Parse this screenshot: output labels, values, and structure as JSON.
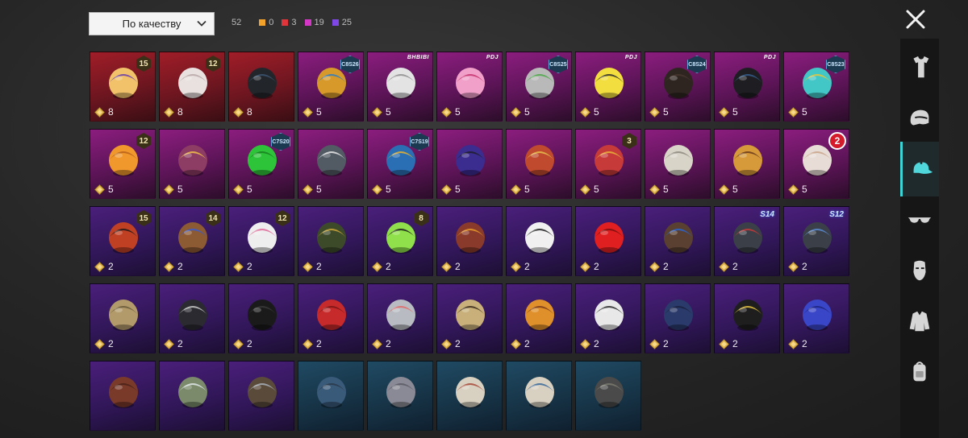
{
  "sort": {
    "label": "По качеству"
  },
  "counts": {
    "total": "52",
    "items": [
      {
        "color": "#f4a32a",
        "value": "0"
      },
      {
        "color": "#e0353b",
        "value": "3"
      },
      {
        "color": "#d437c6",
        "value": "19"
      },
      {
        "color": "#7f47e6",
        "value": "25"
      }
    ]
  },
  "sidebar": {
    "tabs": [
      {
        "icon": "outfit-icon",
        "active": false
      },
      {
        "icon": "helmet-icon",
        "active": false
      },
      {
        "icon": "cap-icon",
        "active": true
      },
      {
        "icon": "glasses-icon",
        "active": false
      },
      {
        "icon": "mask-icon",
        "active": false
      },
      {
        "icon": "jacket-icon",
        "active": false
      },
      {
        "icon": "backpack-icon",
        "active": false
      }
    ]
  },
  "grid": {
    "rows": [
      [
        {
          "rarity": "red",
          "qty": "8",
          "badge": "15",
          "badge_type": "lvl",
          "item": "blonde-hair-bow",
          "c1": "#f1c26a",
          "c2": "#6b3fa8"
        },
        {
          "rarity": "red",
          "qty": "8",
          "badge": "12",
          "badge_type": "lvl",
          "item": "white-hair-ears",
          "c1": "#e8e1df",
          "c2": "#b9a8a8"
        },
        {
          "rarity": "red",
          "qty": "8",
          "badge": "",
          "badge_type": "",
          "item": "dark-helmet-visor",
          "c1": "#22262b",
          "c2": "#3b5470"
        },
        {
          "rarity": "mag",
          "qty": "5",
          "badge": "C8S26",
          "badge_type": "cs",
          "item": "golden-dog-head",
          "c1": "#d79a2a",
          "c2": "#2e7cc1"
        },
        {
          "rarity": "mag",
          "qty": "5",
          "badge": "BHBIBI",
          "badge_type": "logo",
          "item": "security-camera-hat",
          "c1": "#e3e3e3",
          "c2": "#8e8e8e"
        },
        {
          "rarity": "mag",
          "qty": "5",
          "badge": "PDJ",
          "badge_type": "logo",
          "item": "pink-bow-headband",
          "c1": "#f1a0c9",
          "c2": "#c7326f"
        },
        {
          "rarity": "mag",
          "qty": "5",
          "badge": "C8S25",
          "badge_type": "cs",
          "item": "grey-hair-frog",
          "c1": "#b9b9b9",
          "c2": "#4da84a"
        },
        {
          "rarity": "mag",
          "qty": "5",
          "badge": "PDJ",
          "badge_type": "logo",
          "item": "yellow-box-head",
          "c1": "#f2de3f",
          "c2": "#2d2d2d"
        },
        {
          "rarity": "mag",
          "qty": "5",
          "badge": "C8S24",
          "badge_type": "cs",
          "item": "dark-bob-hair",
          "c1": "#2f2520",
          "c2": "#463630"
        },
        {
          "rarity": "mag",
          "qty": "5",
          "badge": "PDJ",
          "badge_type": "logo",
          "item": "black-hair-bun",
          "c1": "#1e1e22",
          "c2": "#355d8a"
        },
        {
          "rarity": "mag",
          "qty": "5",
          "badge": "C8S23",
          "badge_type": "cs",
          "item": "cat-headphones",
          "c1": "#43c6c6",
          "c2": "#e7c43a"
        }
      ],
      [
        {
          "rarity": "mag",
          "qty": "5",
          "badge": "12",
          "badge_type": "lvl",
          "item": "orange-fox-hair",
          "c1": "#f0982c",
          "c2": "#b9621b"
        },
        {
          "rarity": "mag",
          "qty": "5",
          "badge": "",
          "badge_type": "",
          "item": "purple-mohawk-hair",
          "c1": "#8d3c63",
          "c2": "#f0c04a"
        },
        {
          "rarity": "mag",
          "qty": "5",
          "badge": "C7S20",
          "badge_type": "cs",
          "item": "green-pigtails",
          "c1": "#2ec43a",
          "c2": "#16801f"
        },
        {
          "rarity": "mag",
          "qty": "5",
          "badge": "",
          "badge_type": "",
          "item": "shark-hood",
          "c1": "#525a63",
          "c2": "#e8e8e8"
        },
        {
          "rarity": "mag",
          "qty": "5",
          "badge": "C7S19",
          "badge_type": "cs",
          "item": "aztec-feather-headdress",
          "c1": "#2a6fb3",
          "c2": "#e7b32e"
        },
        {
          "rarity": "mag",
          "qty": "5",
          "badge": "",
          "badge_type": "",
          "item": "purple-space-helmet",
          "c1": "#3b2c8f",
          "c2": "#1e1e2a"
        },
        {
          "rarity": "mag",
          "qty": "5",
          "badge": "",
          "badge_type": "",
          "item": "carnival-hat-mask",
          "c1": "#c04a2d",
          "c2": "#e5c04e"
        },
        {
          "rarity": "mag",
          "qty": "5",
          "badge": "3",
          "badge_type": "lvl",
          "item": "jester-hat",
          "c1": "#c73a3a",
          "c2": "#e8b13a"
        },
        {
          "rarity": "mag",
          "qty": "5",
          "badge": "",
          "badge_type": "",
          "item": "lion-mane-mask",
          "c1": "#d9d4c8",
          "c2": "#8e8a80"
        },
        {
          "rarity": "mag",
          "qty": "5",
          "badge": "",
          "badge_type": "",
          "item": "golden-dragon-helmet",
          "c1": "#d69a3a",
          "c2": "#6a3a1c"
        },
        {
          "rarity": "mag",
          "qty": "5",
          "badge": "2",
          "badge_type": "red",
          "item": "bunny-mask",
          "c1": "#e8ddd6",
          "c2": "#c9a48c"
        }
      ],
      [
        {
          "rarity": "pur",
          "qty": "2",
          "badge": "15",
          "badge_type": "lvl",
          "item": "red-masked-hair",
          "c1": "#c04024",
          "c2": "#1f1a1a"
        },
        {
          "rarity": "pur",
          "qty": "2",
          "badge": "14",
          "badge_type": "lvl",
          "item": "brown-hair-blue-bow",
          "c1": "#8c5a33",
          "c2": "#3a5cd1"
        },
        {
          "rarity": "pur",
          "qty": "2",
          "badge": "12",
          "badge_type": "lvl",
          "item": "bunny-ears-helmet",
          "c1": "#eeeeee",
          "c2": "#e06a9a"
        },
        {
          "rarity": "pur",
          "qty": "2",
          "badge": "",
          "badge_type": "",
          "item": "officer-cap",
          "c1": "#3d4a2a",
          "c2": "#c9a43a"
        },
        {
          "rarity": "pur",
          "qty": "2",
          "badge": "8",
          "badge_type": "lvl",
          "item": "green-skull-hood",
          "c1": "#8fe04a",
          "c2": "#1e1e1e"
        },
        {
          "rarity": "pur",
          "qty": "2",
          "badge": "",
          "badge_type": "",
          "item": "aviator-hat-goggles",
          "c1": "#8a3a2a",
          "c2": "#e59a2a"
        },
        {
          "rarity": "pur",
          "qty": "2",
          "badge": "",
          "badge_type": "",
          "item": "white-sun-hat",
          "c1": "#f0f0f0",
          "c2": "#1e1e1e"
        },
        {
          "rarity": "pur",
          "qty": "2",
          "badge": "",
          "badge_type": "",
          "item": "red-mohawk",
          "c1": "#e02020",
          "c2": "#7a0f0f"
        },
        {
          "rarity": "pur",
          "qty": "2",
          "badge": "",
          "badge_type": "",
          "item": "long-brown-hair",
          "c1": "#5a4030",
          "c2": "#2a64d0"
        },
        {
          "rarity": "pur",
          "qty": "2",
          "badge": "S14",
          "badge_type": "s",
          "item": "spartan-helmet-s14",
          "c1": "#3a3f48",
          "c2": "#c43a3a"
        },
        {
          "rarity": "pur",
          "qty": "2",
          "badge": "S12",
          "badge_type": "s",
          "item": "space-helmet-s12",
          "c1": "#3a3f48",
          "c2": "#5a8ad0"
        }
      ],
      [
        {
          "rarity": "pur",
          "qty": "2",
          "badge": "",
          "badge_type": "",
          "item": "scarecrow-hat",
          "c1": "#b39a6a",
          "c2": "#6a5a3a"
        },
        {
          "rarity": "pur",
          "qty": "2",
          "badge": "",
          "badge_type": "",
          "item": "luchador-mask",
          "c1": "#2a2a30",
          "c2": "#c8c8c8"
        },
        {
          "rarity": "pur",
          "qty": "2",
          "badge": "",
          "badge_type": "",
          "item": "black-top-hat",
          "c1": "#1a1a1a",
          "c2": "#3a3a3a"
        },
        {
          "rarity": "pur",
          "qty": "2",
          "badge": "",
          "badge_type": "",
          "item": "red-fedora",
          "c1": "#c72a2a",
          "c2": "#7a1515"
        },
        {
          "rarity": "pur",
          "qty": "2",
          "badge": "",
          "badge_type": "",
          "item": "shark-head-hat",
          "c1": "#b8bcc2",
          "c2": "#e06a6a"
        },
        {
          "rarity": "pur",
          "qty": "2",
          "badge": "",
          "badge_type": "",
          "item": "monster-beanie",
          "c1": "#c9b07a",
          "c2": "#3a2a1a"
        },
        {
          "rarity": "pur",
          "qty": "2",
          "badge": "",
          "badge_type": "",
          "item": "burger-hat",
          "c1": "#e0902a",
          "c2": "#7a3a1a"
        },
        {
          "rarity": "pur",
          "qty": "2",
          "badge": "",
          "badge_type": "",
          "item": "doctor-head-mirror",
          "c1": "#e8e8e8",
          "c2": "#2a2a2a"
        },
        {
          "rarity": "pur",
          "qty": "2",
          "badge": "",
          "badge_type": "",
          "item": "navy-pillbox-hat",
          "c1": "#2a3a6a",
          "c2": "#1a2240"
        },
        {
          "rarity": "pur",
          "qty": "2",
          "badge": "",
          "badge_type": "",
          "item": "black-cap-logo",
          "c1": "#1e1e1e",
          "c2": "#e0c040"
        },
        {
          "rarity": "pur",
          "qty": "2",
          "badge": "",
          "badge_type": "",
          "item": "blue-baseball-cap",
          "c1": "#3a46c8",
          "c2": "#1e2680"
        }
      ],
      [
        {
          "rarity": "pur",
          "qty": "",
          "badge": "",
          "badge_type": "",
          "item": "brown-fedora",
          "c1": "#7a3a2a",
          "c2": "#4a2218"
        },
        {
          "rarity": "pur",
          "qty": "",
          "badge": "",
          "badge_type": "",
          "item": "camo-helmet",
          "c1": "#7a8a6a",
          "c2": "#dfe6e8"
        },
        {
          "rarity": "pur",
          "qty": "",
          "badge": "",
          "badge_type": "",
          "item": "pilot-cap-goggles",
          "c1": "#5a4a3a",
          "c2": "#a8b0b8"
        },
        {
          "rarity": "blu",
          "qty": "",
          "badge": "",
          "badge_type": "",
          "item": "blue-beret",
          "c1": "#3a5a7a",
          "c2": "#2a3a4a"
        },
        {
          "rarity": "blu",
          "qty": "",
          "badge": "",
          "badge_type": "",
          "item": "grey-beret",
          "c1": "#8a8a96",
          "c2": "#5a5a66"
        },
        {
          "rarity": "blu",
          "qty": "",
          "badge": "",
          "badge_type": "",
          "item": "trucker-cap-red",
          "c1": "#d8d0c0",
          "c2": "#a84a3a"
        },
        {
          "rarity": "blu",
          "qty": "",
          "badge": "",
          "badge_type": "",
          "item": "trucker-cap-blue",
          "c1": "#d8d0c0",
          "c2": "#3a6a9a"
        },
        {
          "rarity": "blu",
          "qty": "",
          "badge": "",
          "badge_type": "",
          "item": "camo-patrol-cap",
          "c1": "#4a4a4a",
          "c2": "#7a7a70"
        }
      ]
    ]
  }
}
